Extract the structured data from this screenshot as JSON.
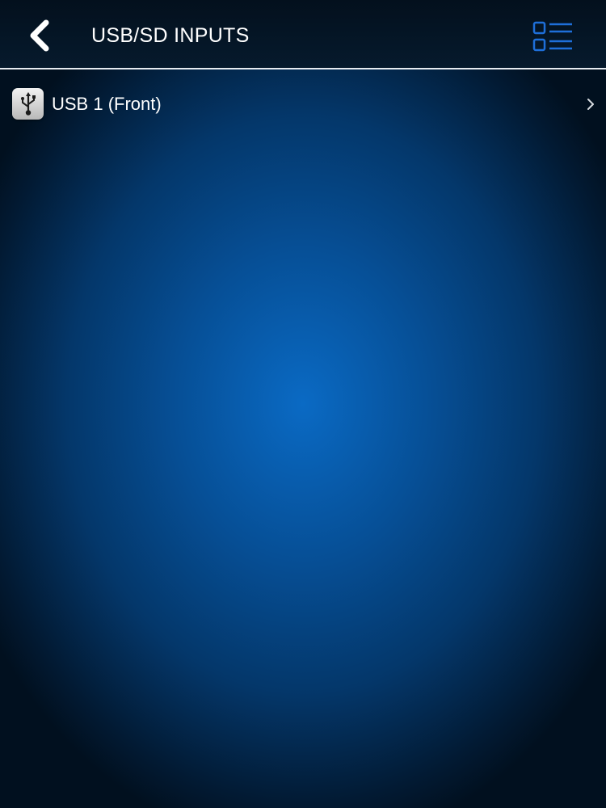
{
  "header": {
    "title": "USB/SD INPUTS",
    "back_icon": "chevron-left-icon",
    "view_toggle_icon": "list-view-icon"
  },
  "inputs": [
    {
      "label": "USB 1 (Front)",
      "icon": "usb-icon",
      "trailing_icon": "chevron-right-icon"
    }
  ],
  "colors": {
    "accent": "#1e6fd9",
    "background_center": "#0a6ac4",
    "background_edge": "#01101f",
    "text": "#ffffff",
    "divider": "#e6ebf0"
  }
}
